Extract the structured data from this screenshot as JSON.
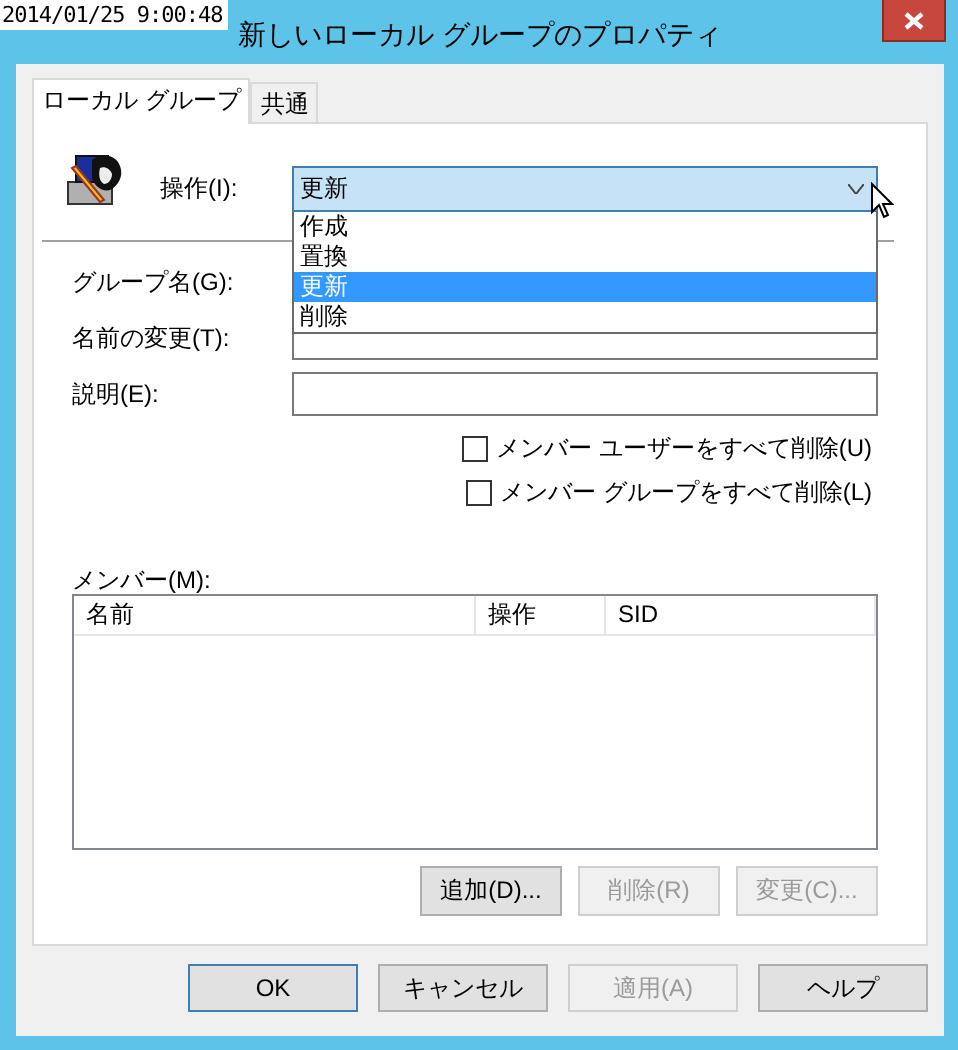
{
  "timestamp": "2014/01/25 9:00:48",
  "window": {
    "title": "新しいローカル グループのプロパティ"
  },
  "tabs": [
    {
      "label": "ローカル グループ",
      "selected": true
    },
    {
      "label": "共通",
      "selected": false
    }
  ],
  "operation": {
    "label": "操作(I):",
    "value": "更新",
    "expanded": true,
    "options": [
      {
        "label": "作成",
        "selected": false
      },
      {
        "label": "置換",
        "selected": false
      },
      {
        "label": "更新",
        "selected": true
      },
      {
        "label": "削除",
        "selected": false
      }
    ]
  },
  "fields": [
    {
      "label": "グループ名(G):",
      "kind": "covered"
    },
    {
      "label": "名前の変更(T):",
      "kind": "text"
    },
    {
      "label": "説明(E):",
      "kind": "text"
    }
  ],
  "checkboxes": [
    {
      "label": "メンバー ユーザーをすべて削除(U)",
      "checked": false
    },
    {
      "label": "メンバー グループをすべて削除(L)",
      "checked": false
    }
  ],
  "members": {
    "label": "メンバー(M):",
    "columns": [
      "名前",
      "操作",
      "SID"
    ]
  },
  "member_buttons": [
    {
      "label": "追加(D)...",
      "disabled": false
    },
    {
      "label": "削除(R)",
      "disabled": true
    },
    {
      "label": "変更(C)...",
      "disabled": true
    }
  ],
  "buttons": [
    {
      "label": "OK",
      "disabled": false,
      "default": true
    },
    {
      "label": "キャンセル",
      "disabled": false,
      "default": false
    },
    {
      "label": "適用(A)",
      "disabled": true,
      "default": false
    },
    {
      "label": "ヘルプ",
      "disabled": false,
      "default": false
    }
  ]
}
